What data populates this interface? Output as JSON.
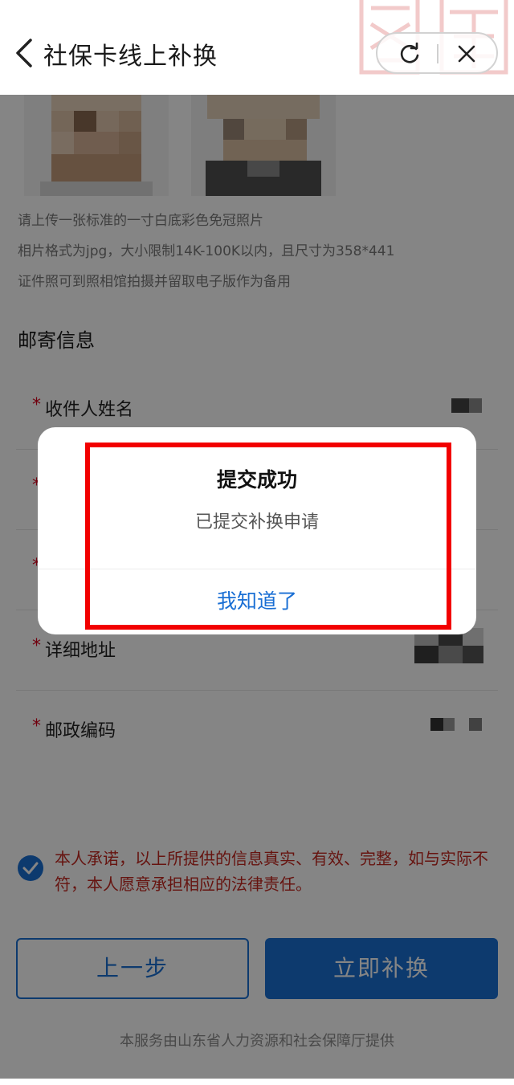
{
  "header": {
    "title": "社保卡线上补换"
  },
  "photo_hints": [
    "请上传一张标准的一寸白底彩色免冠照片",
    "相片格式为jpg，大小限制14K-100K以内，且尺寸为358*441",
    "证件照可到照相馆拍摄并留取电子版作为备用"
  ],
  "mailing": {
    "section_title": "邮寄信息",
    "required_mark": "*",
    "fields": [
      {
        "label": "收件人姓名"
      },
      {
        "label": ""
      },
      {
        "label": ""
      },
      {
        "label": "详细地址"
      },
      {
        "label": "邮政编码"
      }
    ]
  },
  "agreement": {
    "checked": true,
    "text": "本人承诺，以上所提供的信息真实、有效、完整，如与实际不符，本人愿意承担相应的法律责任。"
  },
  "buttons": {
    "prev_label": "上一步",
    "submit_label": "立即补换"
  },
  "footer": {
    "text": "本服务由山东省人力资源和社会保障厅提供"
  },
  "modal": {
    "title": "提交成功",
    "message": "已提交补换申请",
    "confirm_label": "我知道了"
  },
  "colors": {
    "accent": "#1a6fd4",
    "required": "#d9001b",
    "agreement_text": "#c4271f",
    "highlight_border": "#f20000"
  }
}
